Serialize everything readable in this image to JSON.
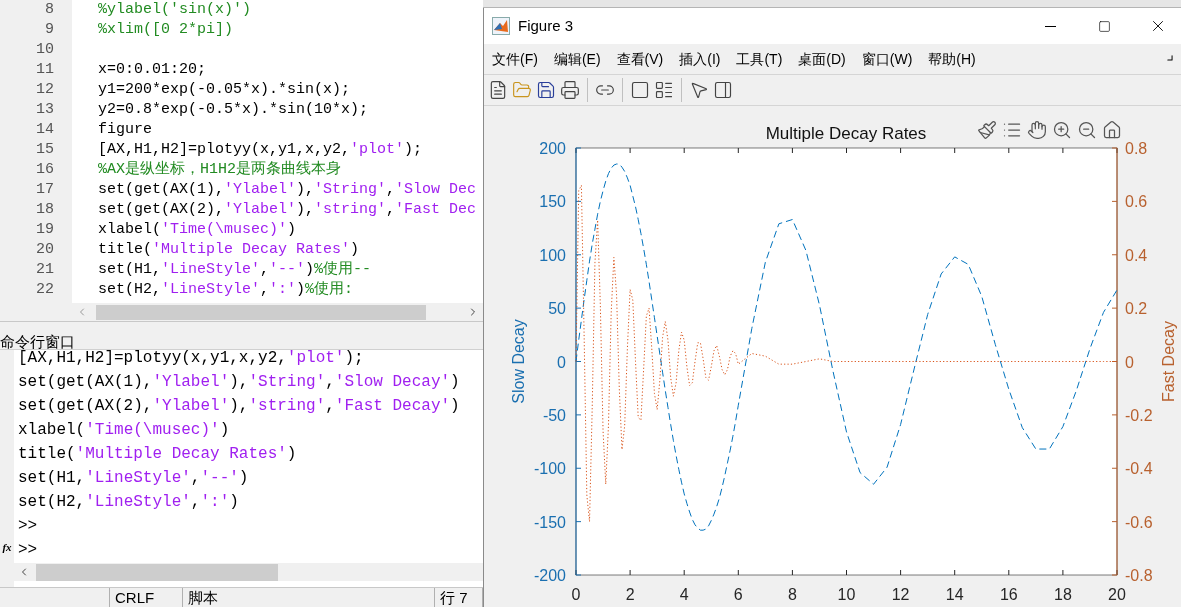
{
  "editor": {
    "lines": [
      {
        "number": "8",
        "segments": [
          {
            "kind": "comment",
            "text": "%ylabel('sin(x)')"
          }
        ]
      },
      {
        "number": "9",
        "segments": [
          {
            "kind": "comment",
            "text": "%xlim([0 2*pi])"
          }
        ]
      },
      {
        "number": "10"
      },
      {
        "number": "11",
        "segments": [
          {
            "kind": "code",
            "text": "x=0:0.01:20;"
          }
        ]
      },
      {
        "number": "12",
        "segments": [
          {
            "kind": "code",
            "text": "y1=200*exp(-0.05*x).*sin(x);"
          }
        ]
      },
      {
        "number": "13",
        "segments": [
          {
            "kind": "code",
            "text": "y2=0.8*exp(-0.5*x).*sin(10*x);"
          }
        ]
      },
      {
        "number": "14",
        "segments": [
          {
            "kind": "code",
            "text": "figure"
          }
        ]
      },
      {
        "number": "15",
        "segments": [
          {
            "kind": "code",
            "text": "[AX,H1,H2]=plotyy(x,y1,x,y2,"
          },
          {
            "kind": "string",
            "text": "'plot'"
          },
          {
            "kind": "code",
            "text": ");"
          }
        ]
      },
      {
        "number": "16",
        "segments": [
          {
            "kind": "comment",
            "text": "%AX是纵坐标，H1H2是两条曲线本身"
          }
        ]
      },
      {
        "number": "17",
        "segments": [
          {
            "kind": "code",
            "text": "set(get(AX(1),"
          },
          {
            "kind": "string",
            "text": "'Ylabel'"
          },
          {
            "kind": "code",
            "text": "),"
          },
          {
            "kind": "string",
            "text": "'String'"
          },
          {
            "kind": "code",
            "text": ","
          },
          {
            "kind": "string",
            "text": "'Slow Dec"
          }
        ]
      },
      {
        "number": "18",
        "segments": [
          {
            "kind": "code",
            "text": "set(get(AX(2),"
          },
          {
            "kind": "string",
            "text": "'Ylabel'"
          },
          {
            "kind": "code",
            "text": "),"
          },
          {
            "kind": "string",
            "text": "'string'"
          },
          {
            "kind": "code",
            "text": ","
          },
          {
            "kind": "string",
            "text": "'Fast Dec"
          }
        ]
      },
      {
        "number": "19",
        "segments": [
          {
            "kind": "code",
            "text": "xlabel("
          },
          {
            "kind": "string",
            "text": "'Time(\\musec)'"
          },
          {
            "kind": "code",
            "text": ")"
          }
        ]
      },
      {
        "number": "20",
        "segments": [
          {
            "kind": "code",
            "text": "title("
          },
          {
            "kind": "string",
            "text": "'Multiple Decay Rates'"
          },
          {
            "kind": "code",
            "text": ")"
          }
        ]
      },
      {
        "number": "21",
        "segments": [
          {
            "kind": "code",
            "text": "set(H1,"
          },
          {
            "kind": "string",
            "text": "'LineStyle'"
          },
          {
            "kind": "code",
            "text": ","
          },
          {
            "kind": "string",
            "text": "'--'"
          },
          {
            "kind": "code",
            "text": ")"
          },
          {
            "kind": "comment",
            "text": "%使用--"
          }
        ]
      },
      {
        "number": "22",
        "segments": [
          {
            "kind": "code",
            "text": "set(H2,"
          },
          {
            "kind": "string",
            "text": "'LineStyle'"
          },
          {
            "kind": "code",
            "text": ","
          },
          {
            "kind": "string",
            "text": "':'"
          },
          {
            "kind": "code",
            "text": ")"
          },
          {
            "kind": "comment",
            "text": "%使用:"
          }
        ]
      }
    ]
  },
  "command_window": {
    "title": "命令行窗口",
    "function_label": "fx",
    "lines": [
      {
        "segments": [
          {
            "kind": "code",
            "text": "[AX,H1,H2]=plotyy(x,y1,x,y2,"
          },
          {
            "kind": "string",
            "text": "'plot'"
          },
          {
            "kind": "code",
            "text": ");"
          }
        ]
      },
      {
        "segments": [
          {
            "kind": "code",
            "text": "set(get(AX(1),"
          },
          {
            "kind": "string",
            "text": "'Ylabel'"
          },
          {
            "kind": "code",
            "text": "),"
          },
          {
            "kind": "string",
            "text": "'String'"
          },
          {
            "kind": "code",
            "text": ","
          },
          {
            "kind": "string",
            "text": "'Slow Decay'"
          },
          {
            "kind": "code",
            "text": ")"
          }
        ]
      },
      {
        "segments": [
          {
            "kind": "code",
            "text": "set(get(AX(2),"
          },
          {
            "kind": "string",
            "text": "'Ylabel'"
          },
          {
            "kind": "code",
            "text": "),"
          },
          {
            "kind": "string",
            "text": "'string'"
          },
          {
            "kind": "code",
            "text": ","
          },
          {
            "kind": "string",
            "text": "'Fast Decay'"
          },
          {
            "kind": "code",
            "text": ")"
          }
        ]
      },
      {
        "segments": [
          {
            "kind": "code",
            "text": "xlabel("
          },
          {
            "kind": "string",
            "text": "'Time(\\musec)'"
          },
          {
            "kind": "code",
            "text": ")"
          }
        ]
      },
      {
        "segments": [
          {
            "kind": "code",
            "text": "title("
          },
          {
            "kind": "string",
            "text": "'Multiple Decay Rates'"
          },
          {
            "kind": "code",
            "text": ")"
          }
        ]
      },
      {
        "segments": [
          {
            "kind": "code",
            "text": "set(H1,"
          },
          {
            "kind": "string",
            "text": "'LineStyle'"
          },
          {
            "kind": "code",
            "text": ","
          },
          {
            "kind": "string",
            "text": "'--'"
          },
          {
            "kind": "code",
            "text": ")"
          }
        ]
      },
      {
        "segments": [
          {
            "kind": "code",
            "text": "set(H2,"
          },
          {
            "kind": "string",
            "text": "'LineStyle'"
          },
          {
            "kind": "code",
            "text": ","
          },
          {
            "kind": "string",
            "text": "':'"
          },
          {
            "kind": "code",
            "text": ")"
          }
        ]
      },
      {
        "segments": [
          {
            "kind": "code",
            "text": ">>"
          }
        ]
      },
      {
        "segments": [
          {
            "kind": "code",
            "text": ">>"
          }
        ]
      }
    ]
  },
  "status_bar": [
    "CRLF",
    "脚本",
    "行 7"
  ],
  "figure": {
    "title": "Figure 3",
    "menu": [
      "文件(F)",
      "编辑(E)",
      "查看(V)",
      "插入(I)",
      "工具(T)",
      "桌面(D)",
      "窗口(W)",
      "帮助(H)"
    ],
    "chart_data": {
      "type": "line",
      "title": "Multiple Decay Rates",
      "ylabel": "Slow Decay",
      "y2label": "Fast Decay",
      "x": [
        0,
        0.1,
        0.2,
        0.3,
        0.4,
        0.5,
        0.6,
        0.7,
        0.8,
        0.9,
        1,
        1.1,
        1.2,
        1.3,
        1.4,
        1.5,
        1.6,
        1.7,
        1.8,
        1.9,
        2,
        2.1,
        2.2,
        2.3,
        2.4,
        2.5,
        2.6,
        2.7,
        2.8,
        2.9,
        3,
        3.1,
        3.2,
        3.3,
        3.4,
        3.5,
        3.6,
        3.7,
        3.8,
        3.9,
        4,
        4.1,
        4.2,
        4.3,
        4.4,
        4.5,
        4.6,
        4.7,
        4.8,
        4.9,
        5,
        5.1,
        5.2,
        5.3,
        5.4,
        5.5,
        5.6,
        5.7,
        5.8,
        5.9,
        6,
        6.5,
        7,
        7.5,
        8,
        8.5,
        9,
        9.5,
        10,
        10.5,
        11,
        11.5,
        12,
        12.5,
        13,
        13.5,
        14,
        14.5,
        15,
        15.5,
        16,
        16.5,
        17,
        17.5,
        18,
        18.5,
        19,
        19.5,
        20
      ],
      "xlim": [
        0,
        20
      ],
      "ylim": [
        -200,
        200
      ],
      "y2lim": [
        -0.8,
        0.8
      ],
      "xticks": [
        0,
        2,
        4,
        6,
        8,
        10,
        12,
        14,
        16,
        18,
        20
      ],
      "yticks": [
        -200,
        -150,
        -100,
        -50,
        0,
        50,
        100,
        150,
        200
      ],
      "y2ticks": [
        -0.8,
        -0.6,
        -0.4,
        -0.2,
        0,
        0.2,
        0.4,
        0.6,
        0.8
      ],
      "series": [
        {
          "color": "#0072bd",
          "line_style": "dashed",
          "values": [
            0,
            20,
            39,
            58,
            76,
            94,
            110,
            124,
            138,
            150,
            160,
            169,
            176,
            181,
            184,
            185,
            185,
            182,
            178,
            172,
            165,
            155,
            145,
            133,
            120,
            106,
            91,
            75,
            58,
            41,
            24,
            7,
            -10,
            -27,
            -43,
            -59,
            -74,
            -88,
            -101,
            -113,
            -124,
            -133,
            -141,
            -148,
            -153,
            -156,
            -158,
            -158,
            -157,
            -154,
            -149,
            -143,
            -136,
            -128,
            -118,
            -107,
            -95,
            -83,
            -70,
            -56,
            -41,
            31,
            93,
            129,
            133,
            104,
            53,
            -9,
            -66,
            -104,
            -115,
            -99,
            -59,
            -7,
            44,
            82,
            98,
            91,
            61,
            16,
            -26,
            -62,
            -82,
            -82,
            -61,
            -27,
            12,
            46,
            67
          ]
        },
        {
          "color": "#d95319",
          "axis": "y2",
          "line_style": "dotted",
          "values": [
            0,
            0.64,
            0.66,
            0.1,
            -0.5,
            -0.6,
            -0.17,
            0.37,
            0.53,
            0.21,
            -0.26,
            -0.46,
            -0.24,
            0.18,
            0.39,
            0.25,
            -0.1,
            -0.33,
            -0.24,
            0.05,
            0.27,
            0.23,
            0,
            -0.21,
            -0.22,
            -0.03,
            0.17,
            0.2,
            0.05,
            -0.12,
            -0.18,
            -0.07,
            0.09,
            0.15,
            0.08,
            -0.06,
            -0.13,
            -0.08,
            0.04,
            0.11,
            0.08,
            -0.02,
            -0.09,
            -0.08,
            0,
            0.07,
            0.07,
            0.01,
            -0.06,
            -0.07,
            -0.02,
            0.04,
            0.06,
            0.02,
            -0.03,
            -0.05,
            -0.03,
            0.02,
            0.04,
            0.03,
            -0.01,
            0.03,
            0.02,
            -0.01,
            -0.01,
            0,
            0.01,
            0,
            0,
            0,
            0,
            0,
            0,
            0,
            0,
            0,
            0,
            0,
            0,
            0,
            0,
            0,
            0,
            0,
            0,
            0,
            0,
            0,
            0
          ]
        }
      ]
    }
  }
}
